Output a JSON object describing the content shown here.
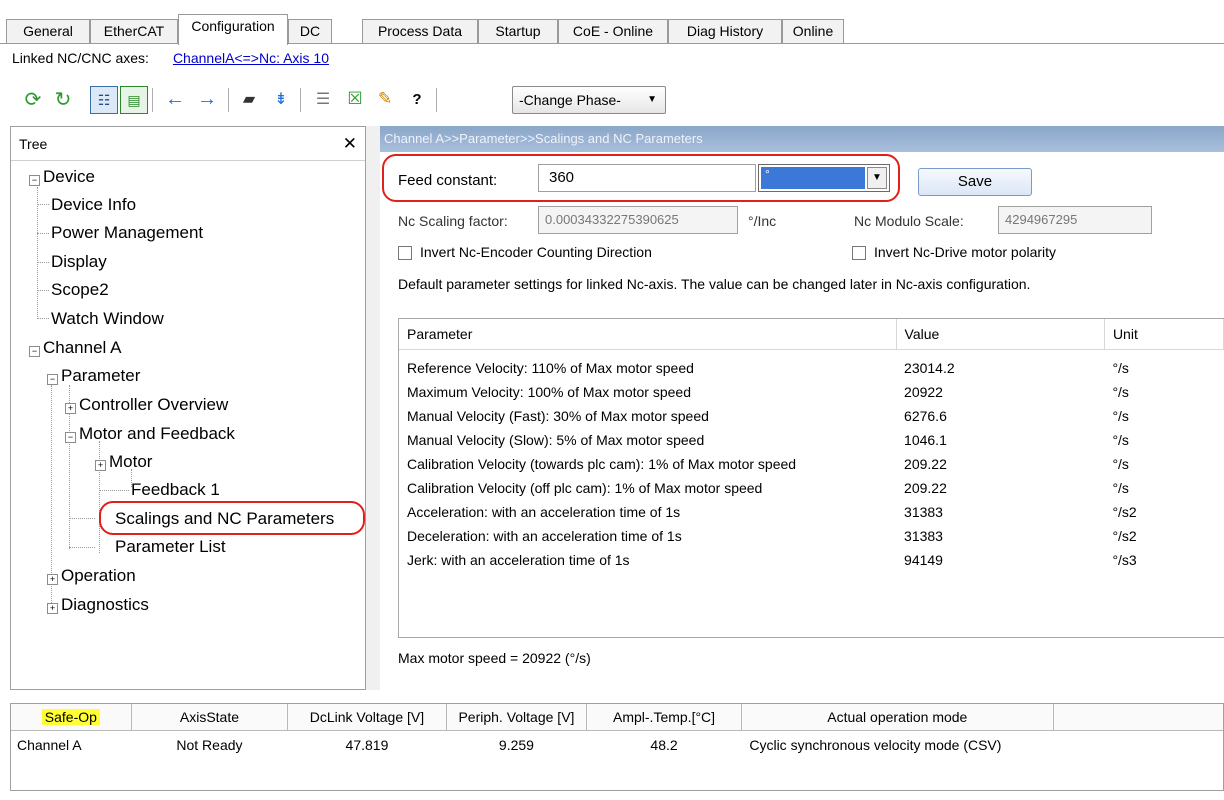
{
  "tabs": [
    "General",
    "EtherCAT",
    "Configuration",
    "DC",
    "Process Data",
    "Startup",
    "CoE - Online",
    "Diag History",
    "Online"
  ],
  "linked": {
    "label": "Linked NC/CNC axes:",
    "link": "ChannelA<=>Nc: Axis 10"
  },
  "toolbar": {
    "phase": "-Change Phase-",
    "help": "?"
  },
  "tree": {
    "header": "Tree",
    "close": "✕",
    "items": {
      "device": "Device",
      "device_info": "Device Info",
      "power": "Power Management",
      "display": "Display",
      "scope2": "Scope2",
      "watch": "Watch Window",
      "channel_a": "Channel A",
      "parameter": "Parameter",
      "controller": "Controller Overview",
      "motor_feedback": "Motor and Feedback",
      "motor": "Motor",
      "feedback1": "Feedback 1",
      "scalings": "Scalings and NC Parameters",
      "param_list": "Parameter List",
      "operation": "Operation",
      "diagnostics": "Diagnostics"
    }
  },
  "panel": {
    "header": "Channel A>>Parameter>>Scalings and NC Parameters",
    "feed_label": "Feed constant:",
    "feed_value": "360",
    "feed_unit": "°",
    "save": "Save",
    "scaling_label": "Nc Scaling factor:",
    "scaling_value": "0.00034332275390625",
    "scaling_unit": "°/Inc",
    "modulo_label": "Nc Modulo Scale:",
    "modulo_value": "4294967295",
    "invert_encoder": "Invert Nc-Encoder Counting Direction",
    "invert_drive": "Invert Nc-Drive motor polarity",
    "default_note": "Default parameter settings for linked Nc-axis. The value can be changed later in Nc-axis configuration.",
    "max_speed": "Max motor speed = 20922 (°/s)"
  },
  "param_table": {
    "headers": {
      "parameter": "Parameter",
      "value": "Value",
      "unit": "Unit"
    },
    "rows": [
      {
        "parameter": "Reference Velocity: 110% of Max motor speed",
        "value": "23014.2",
        "unit": "°/s"
      },
      {
        "parameter": "Maximum Velocity: 100% of Max motor speed",
        "value": "20922",
        "unit": "°/s"
      },
      {
        "parameter": "Manual Velocity (Fast): 30% of Max motor speed",
        "value": "6276.6",
        "unit": "°/s"
      },
      {
        "parameter": "Manual Velocity (Slow): 5% of Max motor speed",
        "value": "1046.1",
        "unit": "°/s"
      },
      {
        "parameter": "Calibration Velocity (towards plc cam): 1% of Max motor speed",
        "value": "209.22",
        "unit": "°/s"
      },
      {
        "parameter": "Calibration Velocity (off plc cam): 1% of Max motor speed",
        "value": "209.22",
        "unit": "°/s"
      },
      {
        "parameter": "Acceleration: with an acceleration time of 1s",
        "value": "31383",
        "unit": "°/s2"
      },
      {
        "parameter": "Deceleration: with an acceleration time of 1s",
        "value": "31383",
        "unit": "°/s2"
      },
      {
        "parameter": "Jerk: with an acceleration time of 1s",
        "value": "94149",
        "unit": "°/s3"
      }
    ]
  },
  "status_table": {
    "headers": [
      "Safe-Op",
      "AxisState",
      "DcLink Voltage [V]",
      "Periph. Voltage [V]",
      "Ampl-.Temp.[°C]",
      "Actual operation mode"
    ],
    "row": [
      "Channel A",
      "Not Ready",
      "47.819",
      "9.259",
      "48.2",
      "Cyclic synchronous velocity mode (CSV)"
    ]
  },
  "colors": {
    "highlight_ring": "#e0201a",
    "safe_op_highlight": "#ffff33",
    "link": "#0000cc",
    "panel_header": "#9bb3d4"
  }
}
